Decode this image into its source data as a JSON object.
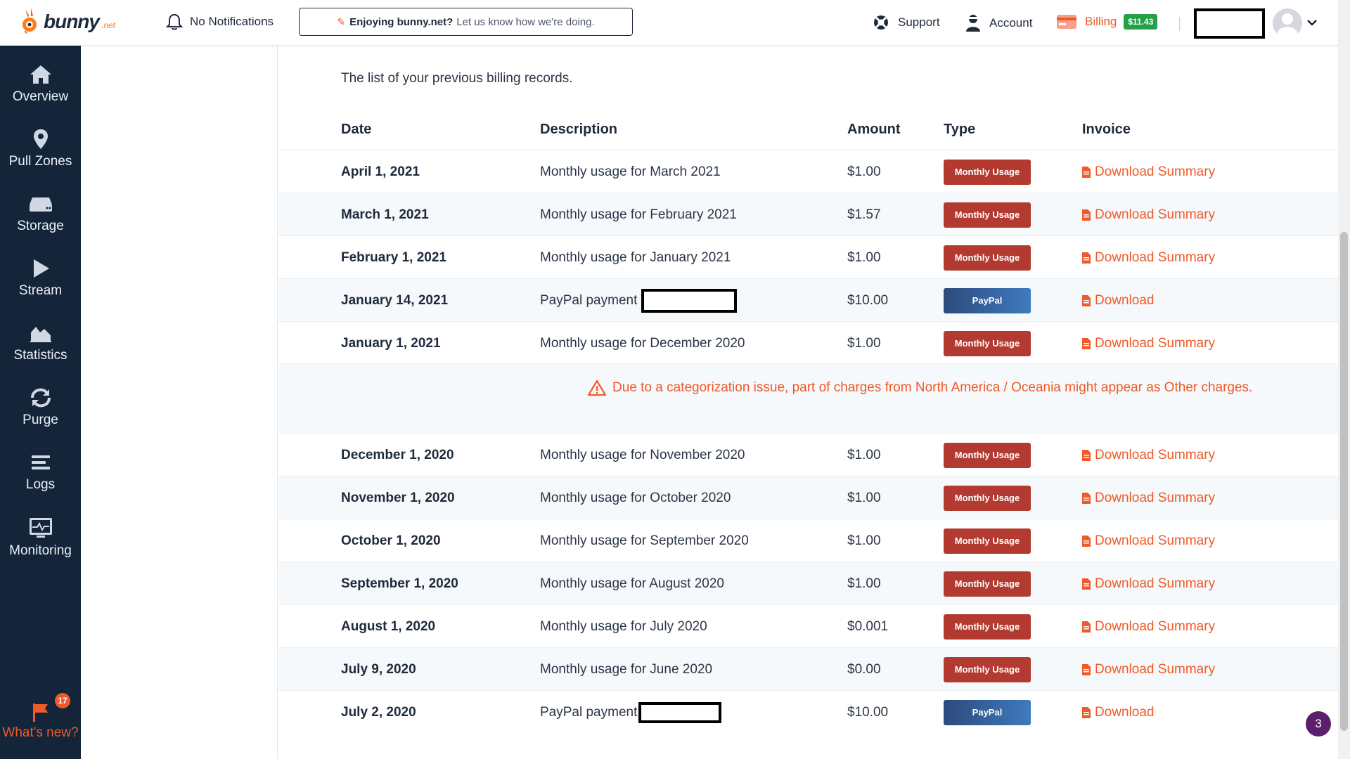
{
  "header": {
    "logo_text": "bunny",
    "logo_suffix": ".net",
    "notifications_label": "No Notifications",
    "feedback_strong": "Enjoying bunny.net?",
    "feedback_text": "Let us know how we're doing.",
    "support_label": "Support",
    "account_label": "Account",
    "billing_label": "Billing",
    "balance": "$11.43"
  },
  "sidebar": {
    "items": [
      {
        "label": "Overview",
        "icon": "home-icon"
      },
      {
        "label": "Pull Zones",
        "icon": "location-pin-icon"
      },
      {
        "label": "Storage",
        "icon": "storage-drive-icon"
      },
      {
        "label": "Stream",
        "icon": "play-icon"
      },
      {
        "label": "Statistics",
        "icon": "area-chart-icon"
      },
      {
        "label": "Purge",
        "icon": "refresh-icon"
      },
      {
        "label": "Logs",
        "icon": "list-lines-icon"
      },
      {
        "label": "Monitoring",
        "icon": "monitor-pulse-icon"
      }
    ],
    "whats_new_label": "What's new?",
    "whats_new_count": "17"
  },
  "billing": {
    "intro": "The list of your previous billing records.",
    "columns": {
      "date": "Date",
      "description": "Description",
      "amount": "Amount",
      "type": "Type",
      "invoice": "Invoice"
    },
    "records": [
      {
        "date": "April 1, 2021",
        "description": "Monthly usage for March 2021",
        "amount": "$1.00",
        "type": "Monthly Usage",
        "invoice": "Download Summary"
      },
      {
        "date": "March 1, 2021",
        "description": "Monthly usage for February 2021",
        "amount": "$1.57",
        "type": "Monthly Usage",
        "invoice": "Download Summary"
      },
      {
        "date": "February 1, 2021",
        "description": "Monthly usage for January 2021",
        "amount": "$1.00",
        "type": "Monthly Usage",
        "invoice": "Download Summary"
      },
      {
        "date": "January 14, 2021",
        "description": "PayPal payment",
        "amount": "$10.00",
        "type": "PayPal",
        "invoice": "Download"
      },
      {
        "date": "January 1, 2021",
        "description": "Monthly usage for December 2020",
        "amount": "$1.00",
        "type": "Monthly Usage",
        "invoice": "Download Summary"
      }
    ],
    "notice": "Due to a categorization issue, part of charges from North America / Oceania might appear as Other charges.",
    "records_after": [
      {
        "date": "December 1, 2020",
        "description": "Monthly usage for November 2020",
        "amount": "$1.00",
        "type": "Monthly Usage",
        "invoice": "Download Summary"
      },
      {
        "date": "November 1, 2020",
        "description": "Monthly usage for October 2020",
        "amount": "$1.00",
        "type": "Monthly Usage",
        "invoice": "Download Summary"
      },
      {
        "date": "October 1, 2020",
        "description": "Monthly usage for September 2020",
        "amount": "$1.00",
        "type": "Monthly Usage",
        "invoice": "Download Summary"
      },
      {
        "date": "September 1, 2020",
        "description": "Monthly usage for August 2020",
        "amount": "$1.00",
        "type": "Monthly Usage",
        "invoice": "Download Summary"
      },
      {
        "date": "August 1, 2020",
        "description": "Monthly usage for July 2020",
        "amount": "$0.001",
        "type": "Monthly Usage",
        "invoice": "Download Summary"
      },
      {
        "date": "July 9, 2020",
        "description": "Monthly usage for June 2020",
        "amount": "$0.00",
        "type": "Monthly Usage",
        "invoice": "Download Summary"
      },
      {
        "date": "July 2, 2020",
        "description": "PayPal payment",
        "amount": "$10.00",
        "type": "PayPal",
        "invoice": "Download"
      }
    ]
  },
  "chat_bubble_count": "3",
  "colors": {
    "sidebar_bg": "#14253a",
    "accent_orange": "#ef5a28",
    "usage_tag": "#b33a30",
    "paypal_tag": "#3e7bbf",
    "balance_green": "#24a148"
  }
}
